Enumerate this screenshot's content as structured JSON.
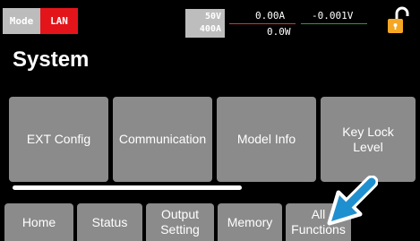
{
  "status_bar": {
    "mode_label": "Mode",
    "interface_label": "LAN",
    "voltage_range": "50V",
    "current_range": "400A",
    "current_reading": "0.00A",
    "voltage_reading": "-0.001V",
    "power_reading": "0.0W"
  },
  "page": {
    "title": "System"
  },
  "tiles": [
    {
      "label": "EXT Config"
    },
    {
      "label": "Communication"
    },
    {
      "label": "Model Info"
    },
    {
      "label": "Key Lock\nLevel"
    }
  ],
  "tabs": [
    {
      "label": "Home"
    },
    {
      "label": "Status"
    },
    {
      "label": "Output\nSetting"
    },
    {
      "label": "Memory"
    },
    {
      "label": "All\nFunctions"
    }
  ],
  "colors": {
    "background": "#000000",
    "tile": "#8b8b8b",
    "lan_badge": "#e3151b",
    "mode_badge": "#bcbcbc",
    "lock_icon": "#f5a623",
    "arrow": "#1e90d0"
  },
  "icons": {
    "lock": "unlocked-padlock-icon",
    "pointer": "arrow-pointer-icon"
  }
}
